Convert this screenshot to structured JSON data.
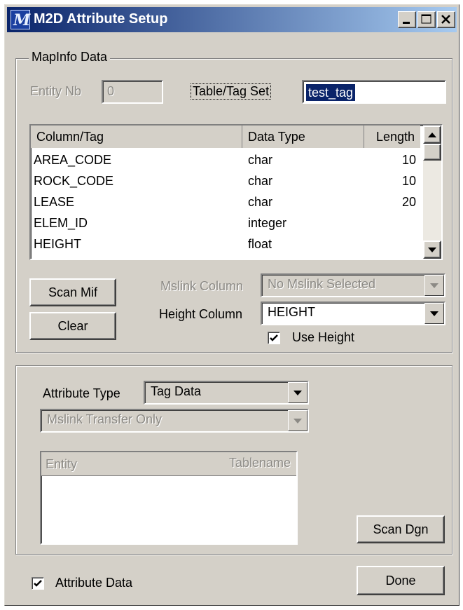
{
  "window": {
    "title": "M2D Attribute Setup",
    "icon": "mapinfo-app-icon"
  },
  "mapinfo_group": {
    "label": "MapInfo Data",
    "entity_nb_label": "Entity Nb",
    "entity_nb_value": "0",
    "table_tag_set_label": "Table/Tag Set",
    "table_tag_set_value": "test_tag",
    "list": {
      "columns": [
        "Column/Tag",
        "Data Type",
        "Length"
      ],
      "rows": [
        {
          "tag": "AREA_CODE",
          "type": "char",
          "length": "10"
        },
        {
          "tag": "ROCK_CODE",
          "type": "char",
          "length": "10"
        },
        {
          "tag": "LEASE",
          "type": "char",
          "length": "20"
        },
        {
          "tag": "ELEM_ID",
          "type": "integer",
          "length": ""
        },
        {
          "tag": "HEIGHT",
          "type": "float",
          "length": ""
        }
      ]
    },
    "scan_mif_label": "Scan Mif",
    "clear_label": "Clear",
    "mslink_column_label": "Mslink Column",
    "mslink_column_value": "No Mslink Selected",
    "height_column_label": "Height Column",
    "height_column_value": "HEIGHT",
    "use_height_label": "Use Height",
    "use_height_checked": true
  },
  "attribute_group": {
    "attribute_type_label": "Attribute Type",
    "attribute_type_value": "Tag Data",
    "transfer_value": "Mslink Transfer Only",
    "list_columns": [
      "Entity",
      "Tablename"
    ],
    "scan_dgn_label": "Scan Dgn"
  },
  "footer": {
    "attribute_data_label": "Attribute Data",
    "attribute_data_checked": true,
    "done_label": "Done"
  },
  "colors": {
    "title_start": "#0a246a",
    "title_end": "#a6caf0",
    "face": "#d4d0c8",
    "selection": "#0a246a"
  }
}
